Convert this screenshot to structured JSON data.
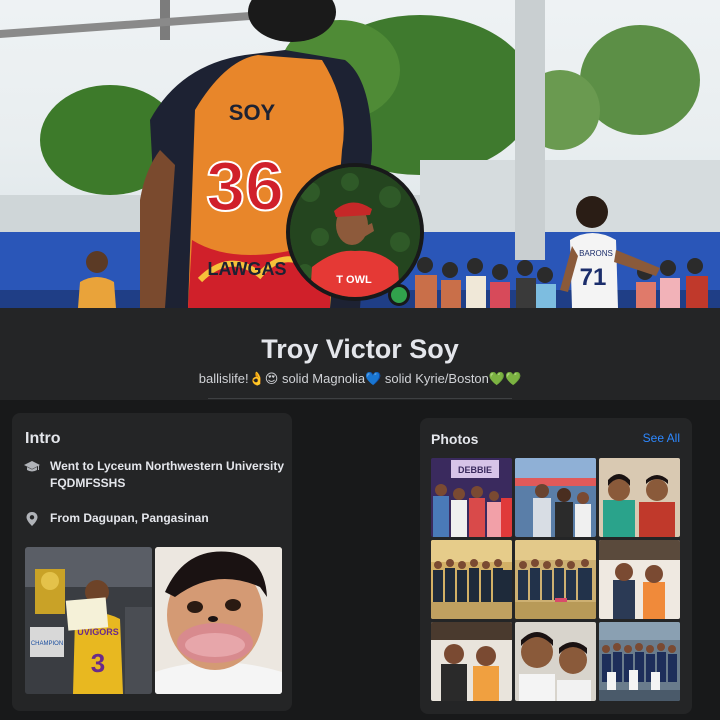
{
  "profile": {
    "name": "Troy Victor Soy",
    "bio": "ballislife!👌😍 solid Magnolia💙 solid Kyrie/Boston💚💚",
    "cover": {
      "jersey_name": "SOY",
      "jersey_number": "36",
      "jersey_team": "LAWGAS",
      "opponent_number": "71",
      "opponent_team": "BARONS"
    },
    "avatar_shirt_text": "T OWL",
    "online": true
  },
  "intro": {
    "title": "Intro",
    "work": "Went to Lyceum Northwestern University FQDMFSSHS",
    "location": "From Dagupan, Pangasinan",
    "work_icon": "graduation-cap-icon",
    "location_icon": "location-pin-icon",
    "featured_photos": [
      {
        "caption": "UVIGORS",
        "jersey_number": "3",
        "sign_text": "CHAMPION"
      },
      {
        "caption": ""
      }
    ]
  },
  "photos": {
    "title": "Photos",
    "see_all_label": "See All",
    "grid": [
      {
        "banner": "DEBBIE"
      },
      {
        "banner": ""
      },
      {
        "banner": ""
      },
      {
        "banner": ""
      },
      {
        "banner": ""
      },
      {
        "banner": ""
      },
      {
        "banner": ""
      },
      {
        "banner": ""
      },
      {
        "banner": ""
      }
    ]
  },
  "colors": {
    "background": "#18191a",
    "card": "#242526",
    "link": "#2d88ff",
    "online": "#31a24c",
    "jersey_orange": "#e8862a",
    "jersey_red": "#d0202a",
    "court_blue": "#2a56b8"
  }
}
